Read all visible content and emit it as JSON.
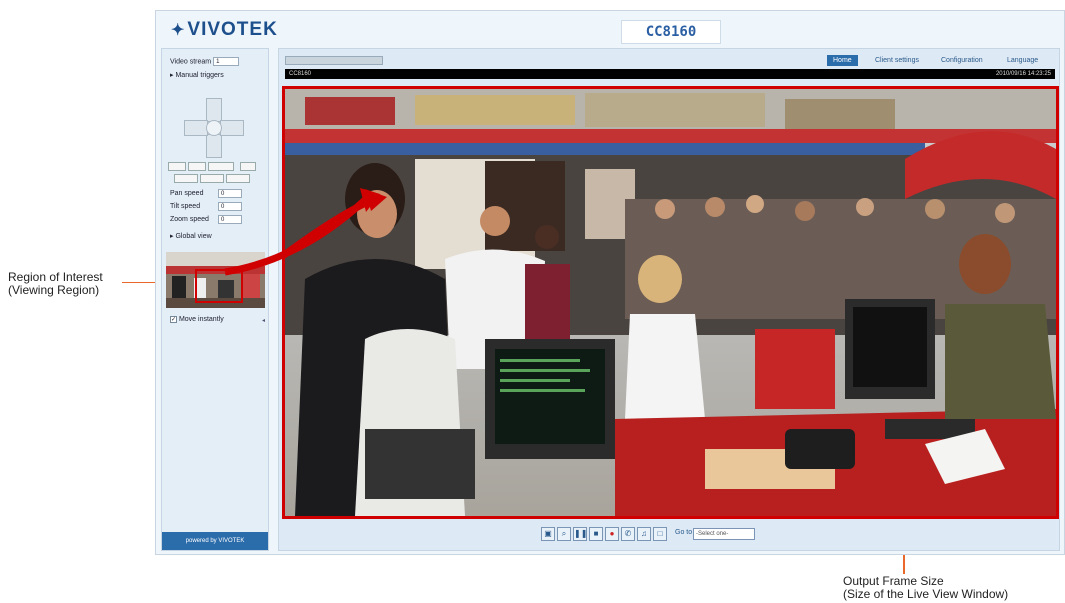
{
  "annotations": {
    "roi_line1": "Region of Interest",
    "roi_line2": "(Viewing Region)",
    "output_line1": "Output Frame Size",
    "output_line2": "(Size of the Live View Window)",
    "accent_red": "#d00000",
    "callout_orange": "#e8692a"
  },
  "header": {
    "brand": "VIVOTEK",
    "model": "CC8160"
  },
  "sidebar": {
    "video_stream_label": "Video stream",
    "video_stream_value": "1",
    "manual_triggers": "Manual triggers",
    "pan_speed_label": "Pan speed",
    "pan_speed_value": "0",
    "tilt_speed_label": "Tilt speed",
    "tilt_speed_value": "0",
    "zoom_speed_label": "Zoom speed",
    "zoom_speed_value": "0",
    "global_view": "Global view",
    "move_instantly": "Move instantly",
    "powered_by": "powered by VIVOTEK"
  },
  "main": {
    "nav_home": "Home",
    "nav_client": "Client settings",
    "nav_config": "Configuration",
    "nav_language": "Language",
    "overlay_left": "CC8160",
    "overlay_right": "2010/09/16 14:23:25",
    "goto_label": "Go to",
    "goto_select": "-Select one-"
  }
}
